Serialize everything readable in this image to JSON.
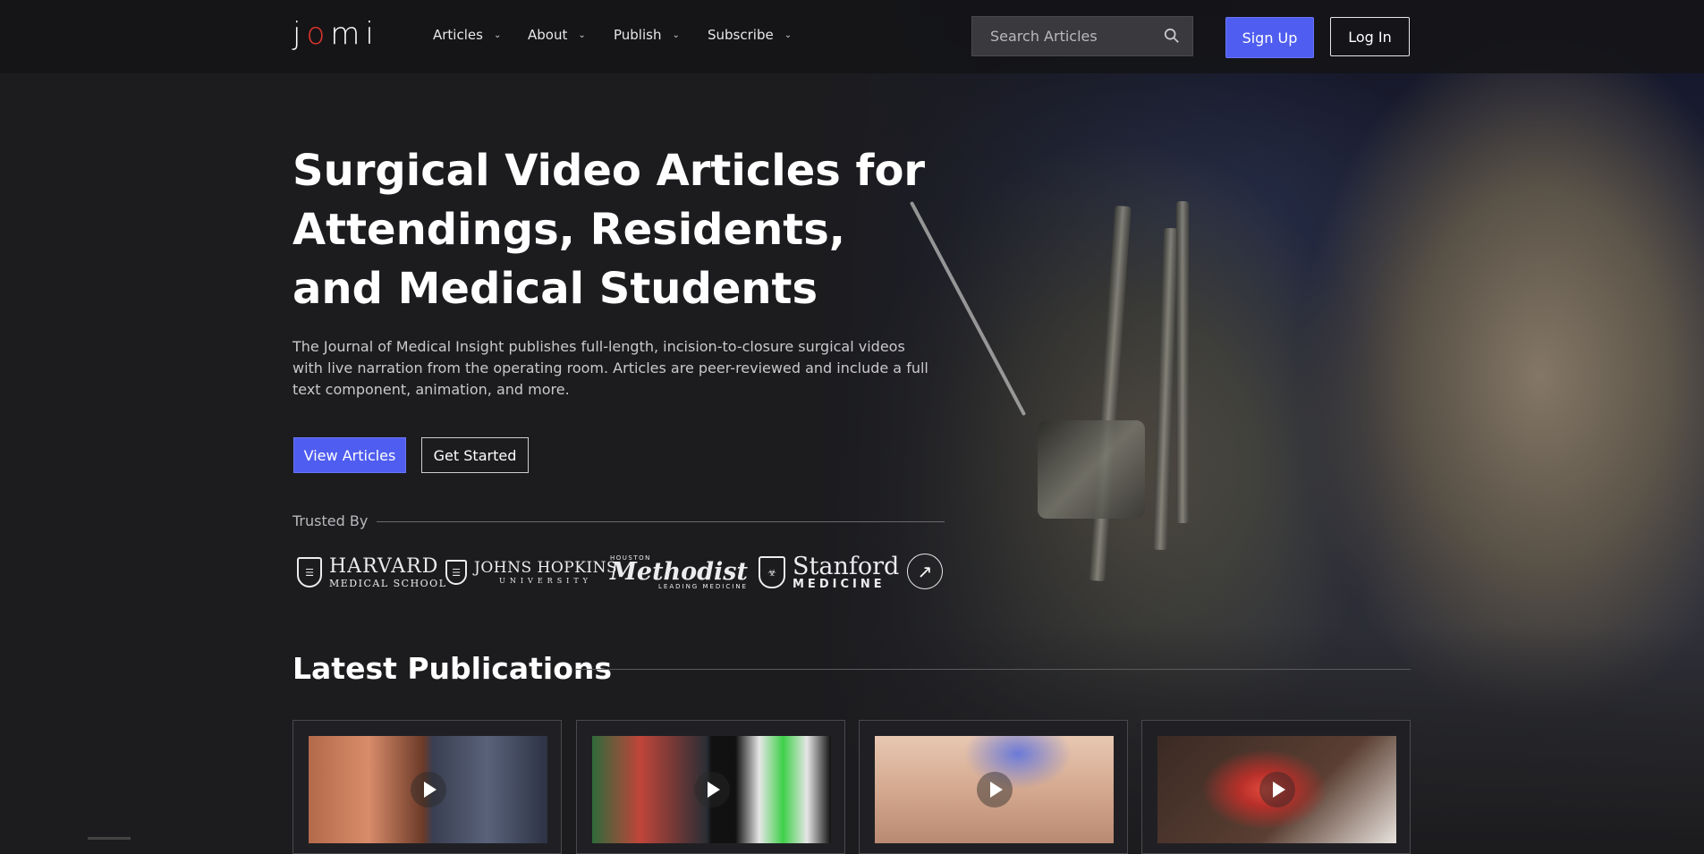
{
  "header": {
    "logo": "jomi",
    "nav": [
      {
        "label": "Articles"
      },
      {
        "label": "About"
      },
      {
        "label": "Publish"
      },
      {
        "label": "Subscribe"
      }
    ],
    "search_placeholder": "Search Articles",
    "sign_up": "Sign Up",
    "log_in": "Log In"
  },
  "hero": {
    "title": "Surgical Video Articles for Attendings, Residents, and Medical Students",
    "description": "The Journal of Medical Insight publishes full-length, incision-to-closure surgical videos with live narration from the operating room. Articles are peer-reviewed and include a full text component, animation, and more.",
    "view_articles": "View Articles",
    "get_started": "Get Started"
  },
  "trusted": {
    "label": "Trusted By",
    "logos": [
      {
        "line1": "HARVARD",
        "line2": "MEDICAL SCHOOL"
      },
      {
        "line1": "JOHNS HOPKINS",
        "line2": "UNIVERSITY"
      },
      {
        "line0": "HOUSTON",
        "line1": "Methodist",
        "line2": "LEADING MEDICINE"
      },
      {
        "line1": "Stanford",
        "line2": "MEDICINE"
      }
    ]
  },
  "latest": {
    "title": "Latest Publications"
  },
  "colors": {
    "accent": "#4f5df0",
    "background": "#1c1c1f",
    "logo_accent": "#e0352f"
  }
}
